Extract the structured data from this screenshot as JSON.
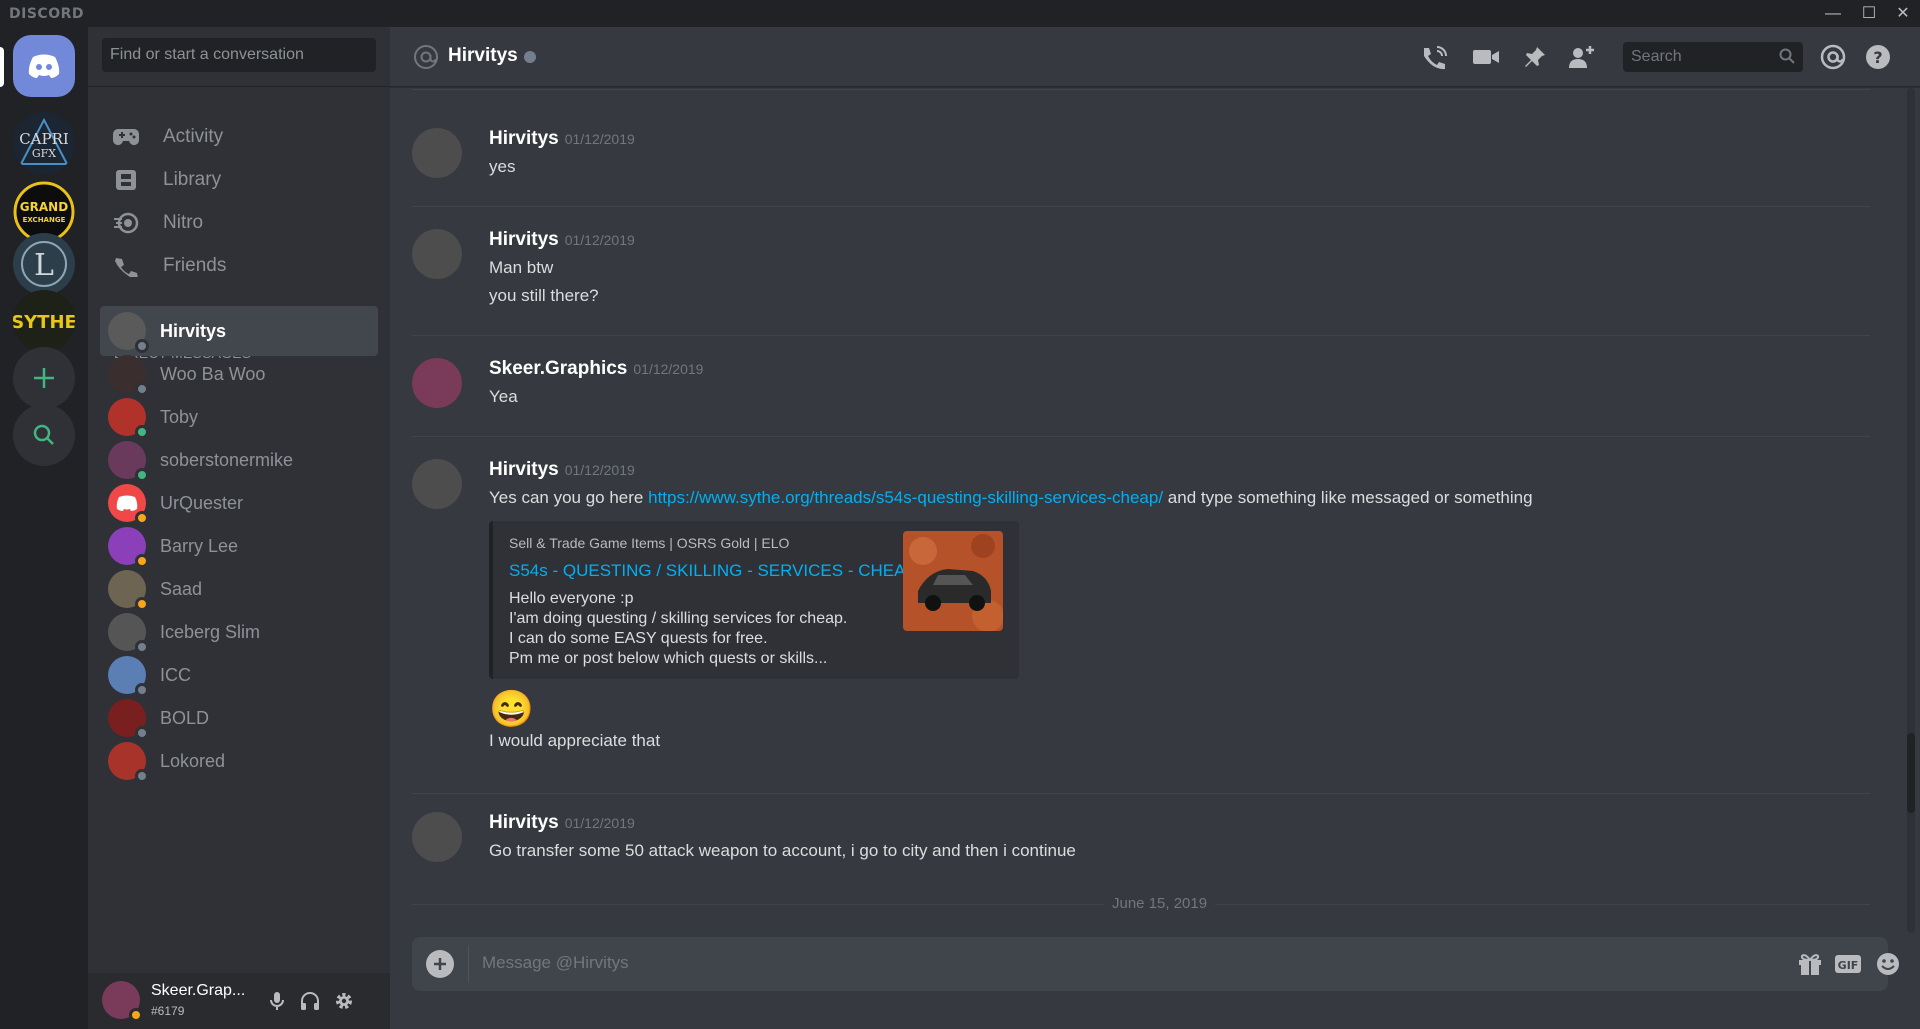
{
  "titlebar": {
    "brand": "DISCORD",
    "minimize": "—",
    "maximize": "☐",
    "close": "✕"
  },
  "sidebar": {
    "search_placeholder": "Find or start a conversation",
    "nav": [
      {
        "label": "Activity",
        "icon": "gamepad-icon"
      },
      {
        "label": "Library",
        "icon": "library-icon"
      },
      {
        "label": "Nitro",
        "icon": "nitro-icon"
      },
      {
        "label": "Friends",
        "icon": "friends-icon"
      }
    ],
    "dm_header": "DIRECT MESSAGES",
    "dms": [
      {
        "name": "Hirvitys",
        "status": "offline",
        "color": "#5a5a5a"
      },
      {
        "name": "Woo Ba Woo",
        "status": "offline",
        "color": "#3b2e2e"
      },
      {
        "name": "Toby",
        "status": "online",
        "color": "#b0322a"
      },
      {
        "name": "soberstonermike",
        "status": "online",
        "color": "#6a3a5c"
      },
      {
        "name": "UrQuester",
        "status": "idle",
        "color": "#f04747"
      },
      {
        "name": "Barry Lee",
        "status": "idle",
        "color": "#8b3fb8"
      },
      {
        "name": "Saad",
        "status": "idle",
        "color": "#6e6452"
      },
      {
        "name": "Iceberg Slim",
        "status": "offline",
        "color": "#555555"
      },
      {
        "name": "ICC",
        "status": "offline",
        "color": "#5b7fb5"
      },
      {
        "name": "BOLD",
        "status": "offline",
        "color": "#7a1f1f"
      },
      {
        "name": "Lokored",
        "status": "offline",
        "color": "#a8332b"
      }
    ],
    "user": {
      "name": "Skeer.Grap...",
      "tag": "#6179"
    }
  },
  "guilds": [
    {
      "name": "CAPRI GFX"
    },
    {
      "name": "GRAND EXCHANGE"
    },
    {
      "name": "L"
    },
    {
      "name": "SYTHE"
    }
  ],
  "header": {
    "channel": "Hirvitys",
    "search_placeholder": "Search"
  },
  "messages": [
    {
      "author": "Hirvitys",
      "time": "01/12/2019",
      "lines": [
        "yes"
      ]
    },
    {
      "author": "Hirvitys",
      "time": "01/12/2019",
      "lines": [
        "Man btw",
        "you still there?"
      ]
    },
    {
      "author": "Skeer.Graphics",
      "time": "01/12/2019",
      "lines": [
        "Yea"
      ]
    },
    {
      "author": "Hirvitys",
      "time": "01/12/2019",
      "text_before": "Yes can you go here ",
      "link": "https://www.sythe.org/threads/s54s-questing-skilling-services-cheap/",
      "text_after": " and type something like messaged or something",
      "embed": {
        "provider": "Sell & Trade Game Items | OSRS Gold | ELO",
        "title": "S54s - QUESTING / SKILLING - SERVICES - CHEAP",
        "desc": [
          "Hello everyone :p",
          "I'am doing questing / skilling services for cheap.",
          "I can do some EASY quests for free.",
          "Pm me or post below which quests or skills..."
        ]
      },
      "emoji": "😄",
      "after": "I would appreciate that"
    },
    {
      "author": "Hirvitys",
      "time": "01/12/2019",
      "lines": [
        "Go transfer some 50 attack weapon to account, i go to city and then i continue"
      ]
    }
  ],
  "date_divider": "June 15, 2019",
  "composer": {
    "placeholder": "Message @Hirvitys",
    "gif": "GIF"
  },
  "colors": {
    "blurple": "#7289da",
    "online": "#43b581",
    "idle": "#faa61a",
    "offline": "#747f8d",
    "link": "#00b0f4"
  }
}
